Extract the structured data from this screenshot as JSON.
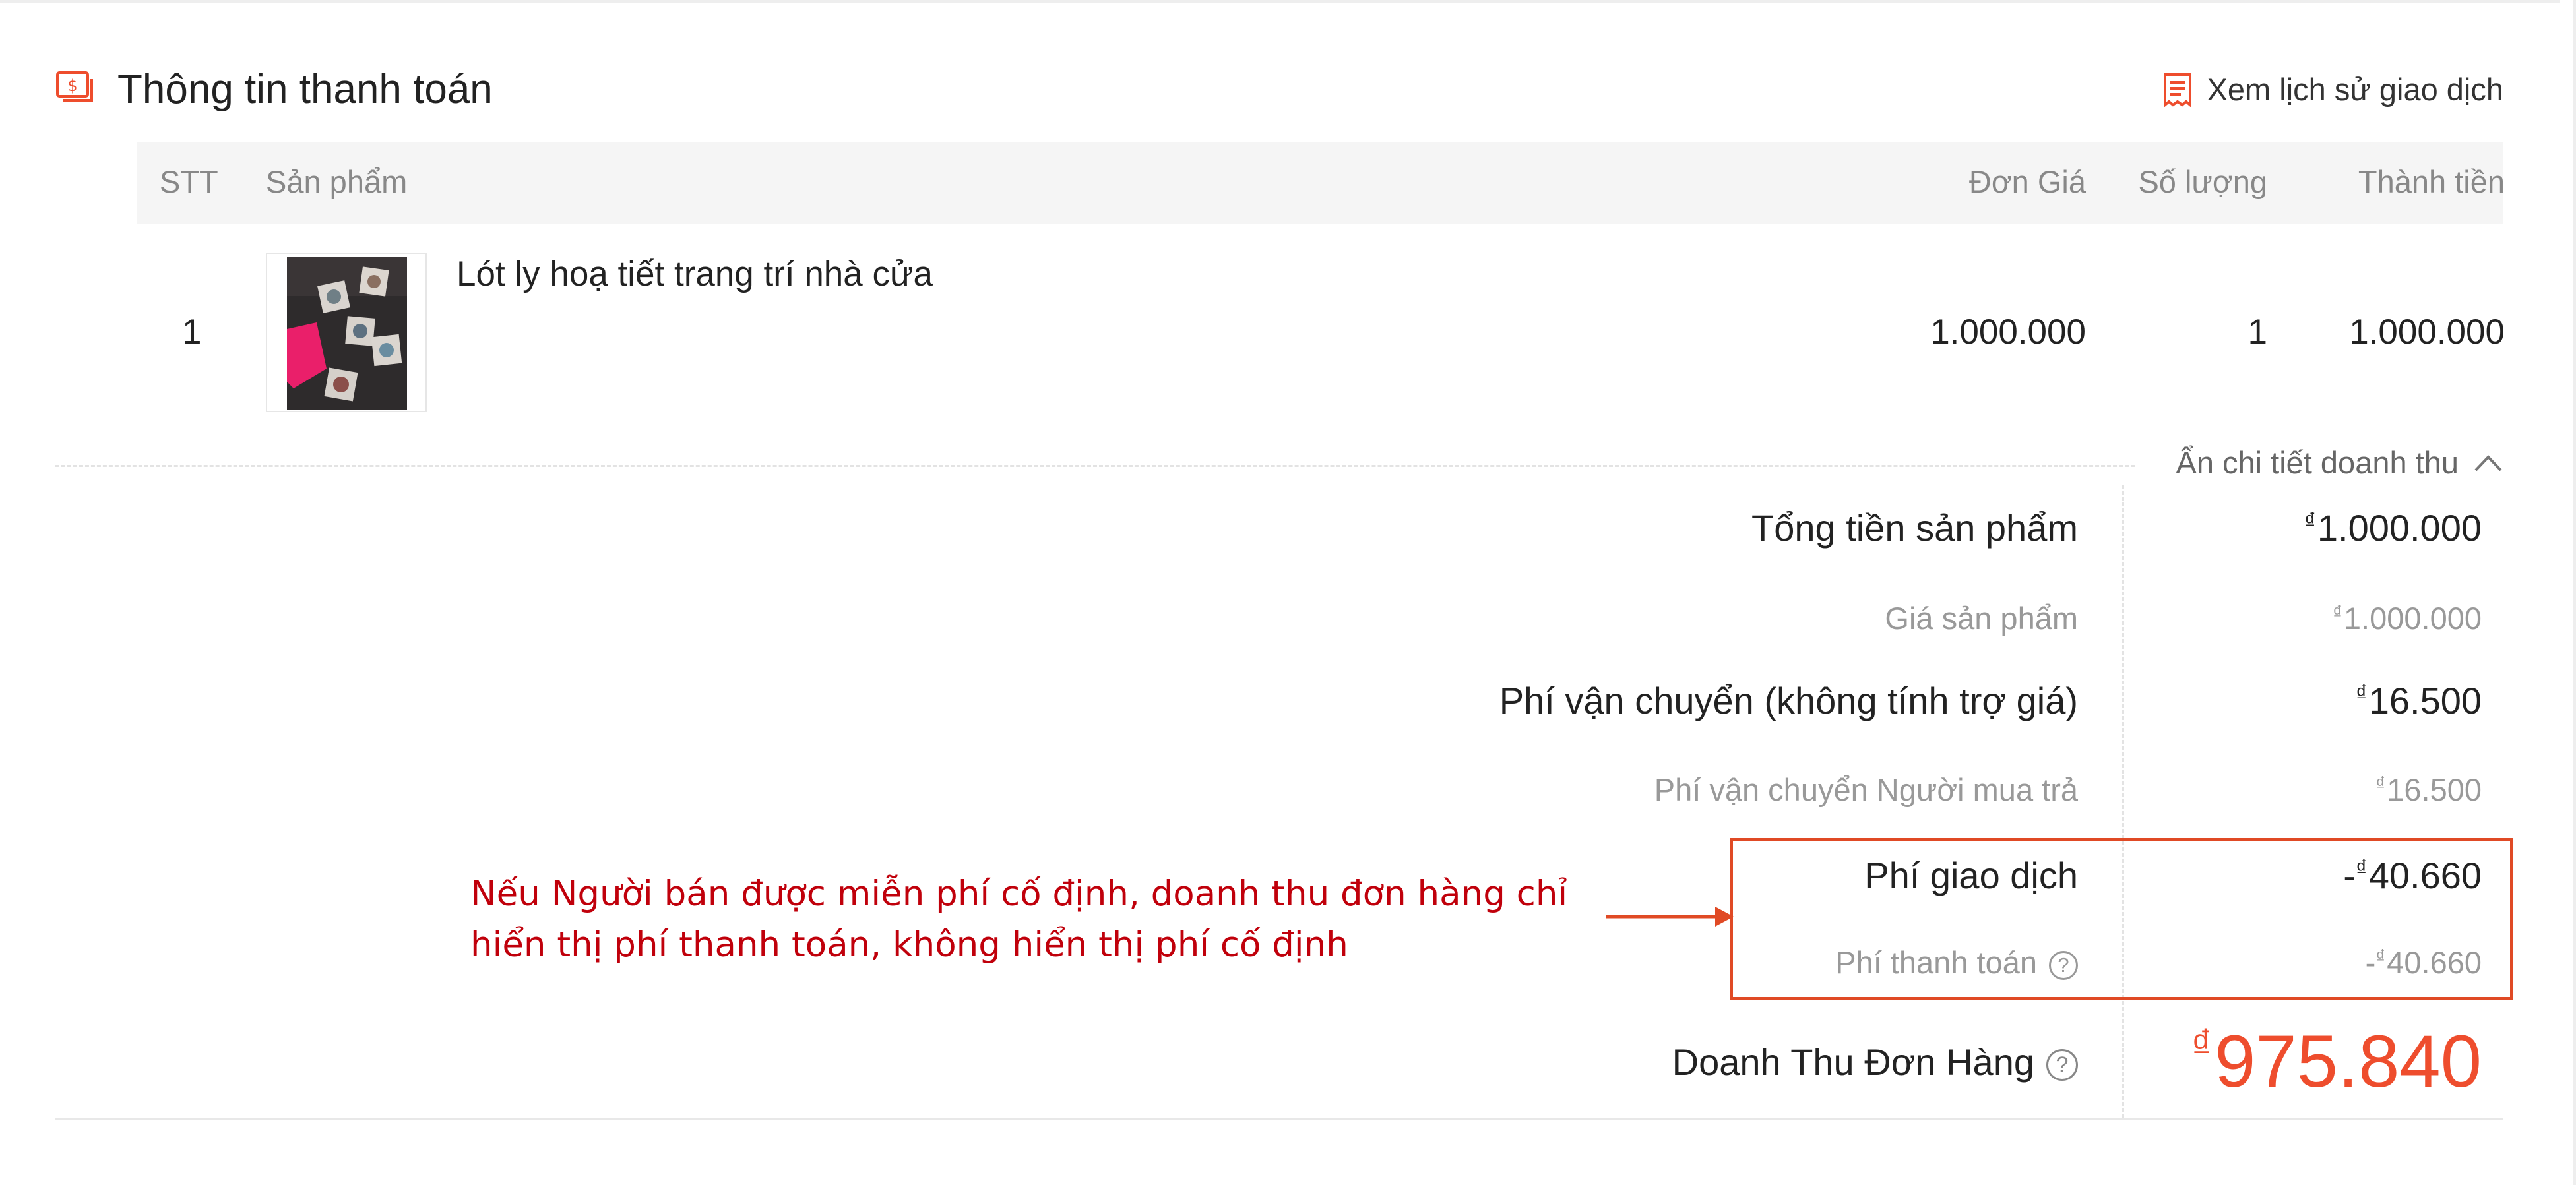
{
  "section": {
    "title": "Thông tin thanh toán",
    "history_link": "Xem lịch sử giao dịch",
    "icons": {
      "section": "payment-money-icon",
      "history": "receipt-icon"
    },
    "accent_color": "#ee4d2d"
  },
  "table": {
    "headers": {
      "stt": "STT",
      "product": "Sản phẩm",
      "unit_price": "Đơn Giá",
      "quantity": "Số lượng",
      "total": "Thành tiền"
    },
    "rows": [
      {
        "stt": "1",
        "product_name": "Lót ly hoạ tiết trang trí nhà cửa",
        "unit_price": "1.000.000",
        "quantity": "1",
        "total": "1.000.000"
      }
    ]
  },
  "details": {
    "toggle_label": "Ẩn chi tiết doanh thu",
    "currency": "₫",
    "items": {
      "product_total_label": "Tổng tiền sản phẩm",
      "product_total_value": "1.000.000",
      "product_price_label": "Giá sản phẩm",
      "product_price_value": "1.000.000",
      "shipping_label": "Phí vận chuyển (không tính trợ giá)",
      "shipping_value": "16.500",
      "shipping_buyer_label": "Phí vận chuyển Người mua trả",
      "shipping_buyer_value": "16.500",
      "transaction_fee_label": "Phí giao dịch",
      "transaction_fee_value": "40.660",
      "payment_fee_label": "Phí thanh toán",
      "payment_fee_value": "40.660",
      "negative_sign": "-"
    },
    "revenue_label": "Doanh Thu Đơn Hàng",
    "revenue_value": "975.840",
    "help_glyph": "?"
  },
  "annotation": {
    "text": "Nếu Người bán được miễn phí cố định, doanh thu đơn hàng chỉ hiển thị phí thanh toán, không hiển thị phí cố định",
    "color": "#c0000b",
    "box_color": "#e04a25"
  }
}
